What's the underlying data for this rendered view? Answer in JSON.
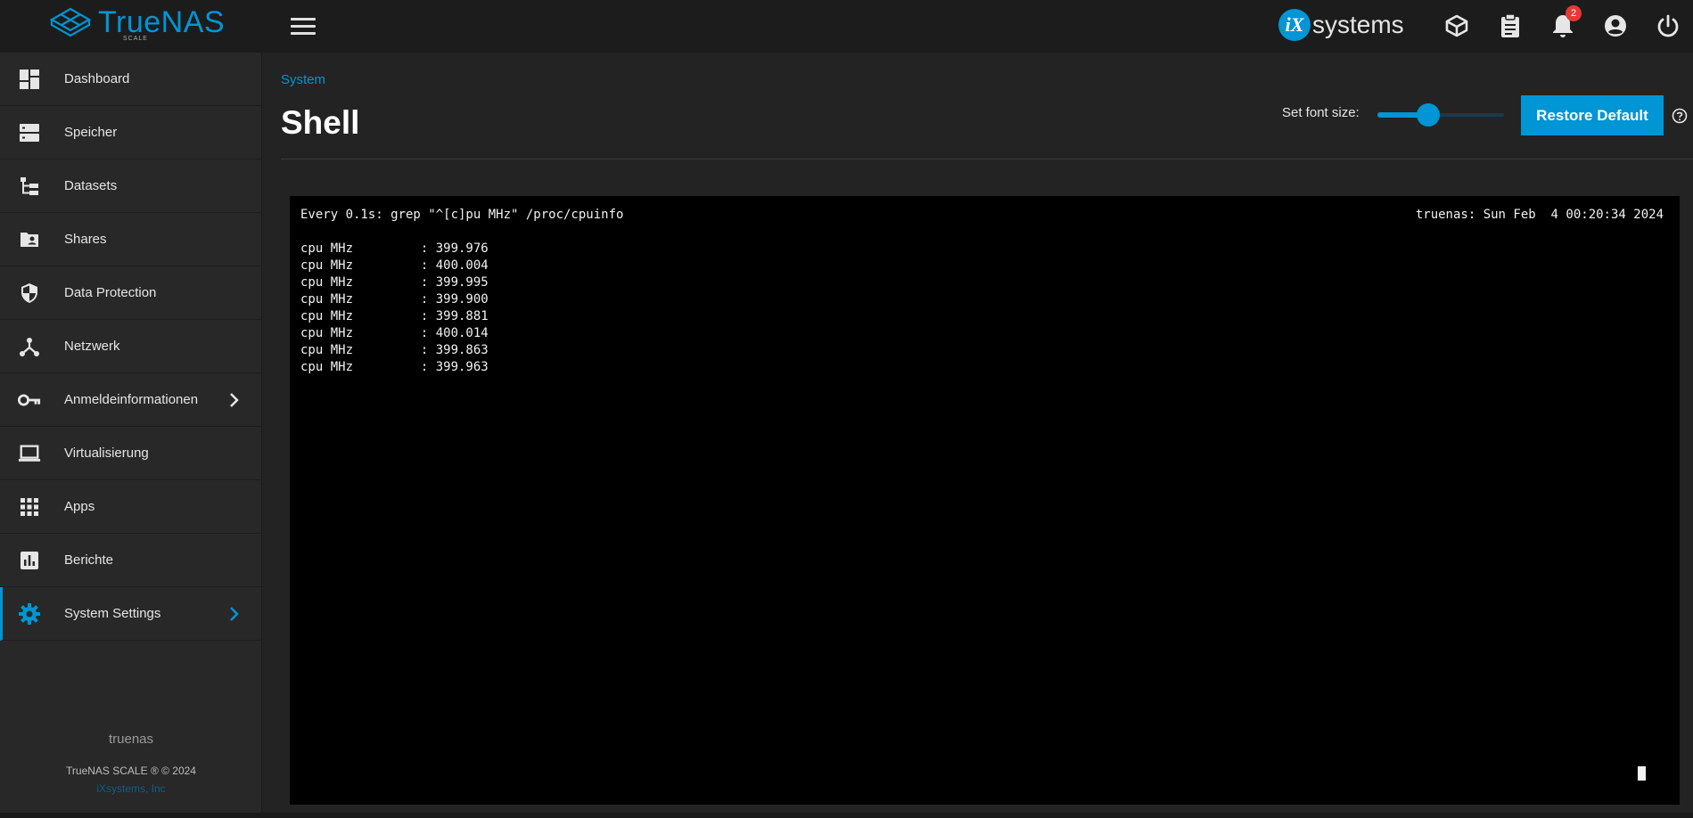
{
  "brand": {
    "name": "TrueNAS",
    "edition": "SCALE",
    "vendor_logo_letters": "iX",
    "vendor_logo_text": "systems"
  },
  "topbar": {
    "notifications_count": "2"
  },
  "sidebar": {
    "items": [
      {
        "label": "Dashboard",
        "icon": "dashboard-icon",
        "has_chevron": false
      },
      {
        "label": "Speicher",
        "icon": "storage-icon",
        "has_chevron": false
      },
      {
        "label": "Datasets",
        "icon": "datasets-icon",
        "has_chevron": false
      },
      {
        "label": "Shares",
        "icon": "shares-icon",
        "has_chevron": false
      },
      {
        "label": "Data Protection",
        "icon": "shield-icon",
        "has_chevron": false
      },
      {
        "label": "Netzwerk",
        "icon": "network-icon",
        "has_chevron": false
      },
      {
        "label": "Anmeldeinformationen",
        "icon": "key-icon",
        "has_chevron": true
      },
      {
        "label": "Virtualisierung",
        "icon": "laptop-icon",
        "has_chevron": false
      },
      {
        "label": "Apps",
        "icon": "apps-icon",
        "has_chevron": false
      },
      {
        "label": "Berichte",
        "icon": "reports-icon",
        "has_chevron": false
      },
      {
        "label": "System Settings",
        "icon": "gear-icon",
        "has_chevron": true,
        "active": true
      }
    ],
    "hostname": "truenas",
    "copyright": "TrueNAS SCALE ® © 2024",
    "company": "iXsystems, Inc"
  },
  "main": {
    "breadcrumb": "System",
    "title": "Shell",
    "font_size_label": "Set font size:",
    "font_size_slider_fraction": 0.4,
    "restore_button": "Restore Default"
  },
  "terminal": {
    "header_left": "Every 0.1s: grep \"^[c]pu MHz\" /proc/cpuinfo",
    "header_right": "truenas: Sun Feb  4 00:20:34 2024",
    "lines": [
      "cpu MHz         : 399.976",
      "cpu MHz         : 400.004",
      "cpu MHz         : 399.995",
      "cpu MHz         : 399.900",
      "cpu MHz         : 399.881",
      "cpu MHz         : 400.014",
      "cpu MHz         : 399.863",
      "cpu MHz         : 399.963"
    ]
  },
  "colors": {
    "accent": "#0095d5",
    "background": "#232323",
    "sidebar": "#282828",
    "topbar": "#1c1c1c",
    "badge": "#e53935"
  }
}
